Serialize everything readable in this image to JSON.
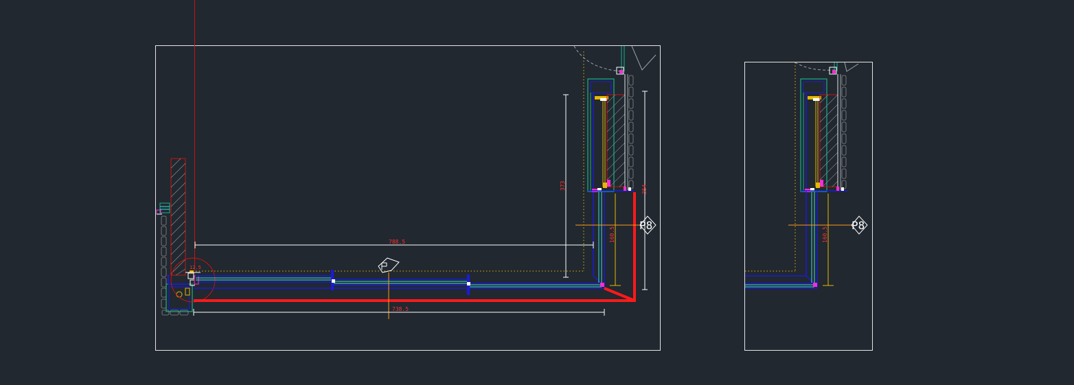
{
  "canvas": {
    "background": "#212830",
    "colors": {
      "frame": "#e6e6e6",
      "red": "#ff1a1a",
      "dim": "#ffffff",
      "dimtext": "#ff3030",
      "green": "#18b08a",
      "blue": "#1b1bd8",
      "cyan": "#40e0e0",
      "yellow": "#e6b800",
      "orange": "#ff9a1a",
      "magenta": "#ff2bd6",
      "hatch": "#8a8a8a",
      "grayline": "#9aa3ad"
    }
  },
  "viewport_main": {
    "dim_top": "788.5",
    "dim_bottom": "738.5",
    "dim_vertical_left": "373",
    "dim_vertical_right": "354",
    "dim_vertical_mid": "160.5",
    "detail_callout": "12.5",
    "section_tag": "P8"
  },
  "viewport_detail": {
    "dim_vertical_mid": "160.5",
    "section_tag": "P8"
  }
}
